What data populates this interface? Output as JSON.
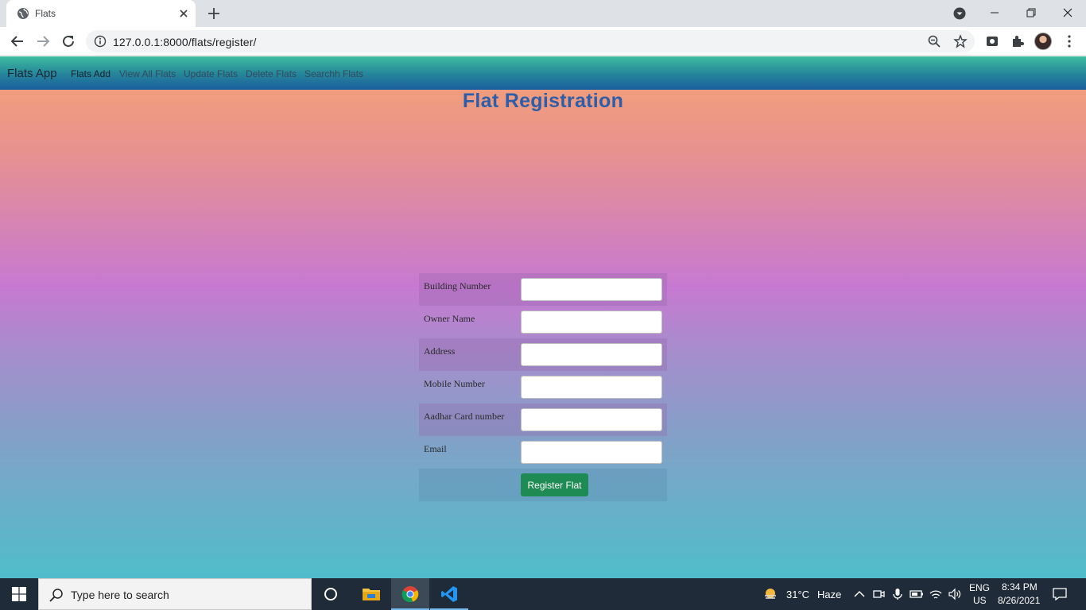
{
  "browser": {
    "tab_title": "Flats",
    "url": "127.0.0.1:8000/flats/register/"
  },
  "navbar": {
    "brand": "Flats App",
    "links": [
      {
        "label": "Flats Add",
        "active": true
      },
      {
        "label": "View All Flats",
        "active": false
      },
      {
        "label": "Update Flats",
        "active": false
      },
      {
        "label": "Delete Flats",
        "active": false
      },
      {
        "label": "Searchh Flats",
        "active": false
      }
    ]
  },
  "page": {
    "heading": "Flat Registration"
  },
  "form": {
    "fields": [
      {
        "label": "Building Number",
        "value": ""
      },
      {
        "label": "Owner Name",
        "value": ""
      },
      {
        "label": "Address",
        "value": ""
      },
      {
        "label": "Mobile Number",
        "value": ""
      },
      {
        "label": "Aadhar Card number",
        "value": ""
      },
      {
        "label": "Email",
        "value": ""
      }
    ],
    "submit_label": "Register Flat"
  },
  "taskbar": {
    "search_placeholder": "Type here to search",
    "weather_temp": "31°C",
    "weather_desc": "Haze",
    "lang": "ENG",
    "region": "US",
    "time": "8:34 PM",
    "date": "8/26/2021"
  },
  "colors": {
    "nav_gradient_top": "#3ebd9f",
    "nav_gradient_bottom": "#1b5e9e",
    "heading": "#2e5ea8",
    "submit_button": "#1e8b54",
    "taskbar": "#1f2b38"
  }
}
